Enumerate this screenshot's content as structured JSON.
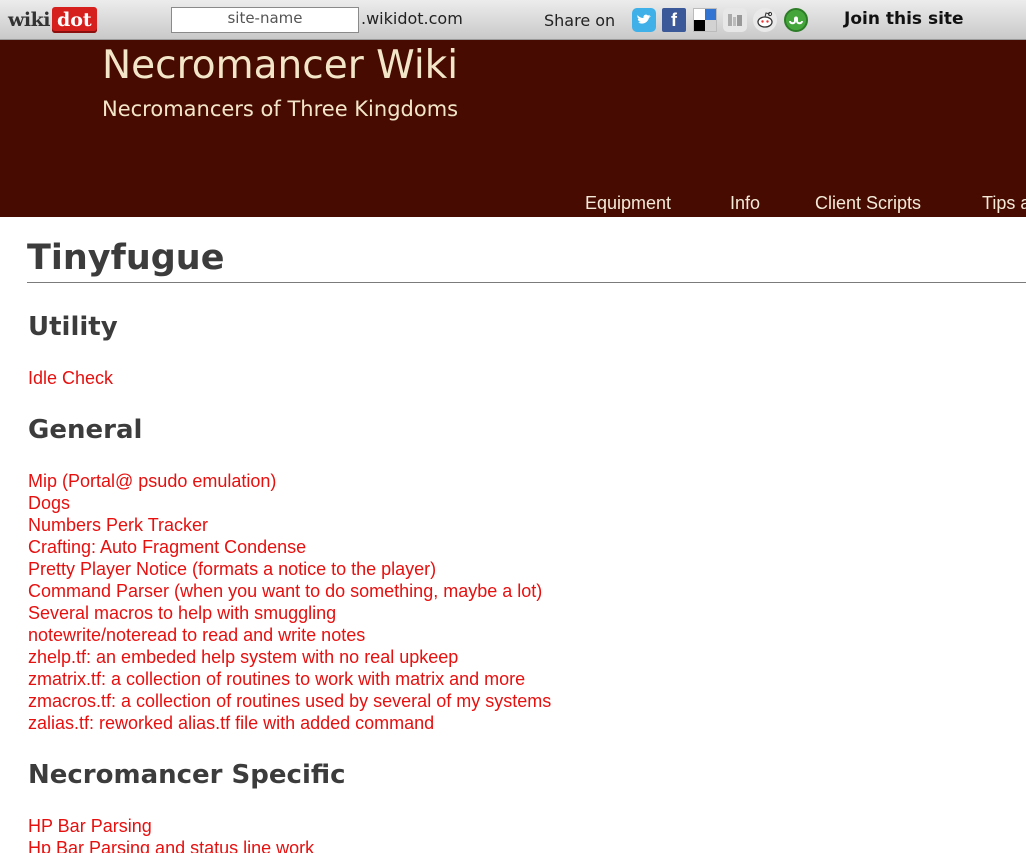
{
  "wikidot_bar": {
    "logo_wiki": "wiki",
    "logo_dot": "dot",
    "site_name_placeholder": "site-name",
    "domain_suffix": ".wikidot.com",
    "share_label": "Share on",
    "share_icons": [
      "twitter-icon",
      "facebook-icon",
      "delicious-icon",
      "digg-icon",
      "reddit-icon",
      "stumbleupon-icon"
    ],
    "facebook_glyph": "f",
    "join_label": "Join this site"
  },
  "header": {
    "title": "Necromancer Wiki",
    "subtitle": "Necromancers of Three Kingdoms",
    "background_color": "#470b02",
    "text_color": "#f3e6c8"
  },
  "nav": {
    "items": [
      "Equipment",
      "Info",
      "Client Scripts",
      "Tips a"
    ]
  },
  "page": {
    "title": "Tinyfugue",
    "link_color": "#e6100f",
    "sections": [
      {
        "heading": "Utility",
        "links": [
          "Idle Check"
        ]
      },
      {
        "heading": "General",
        "links": [
          "Mip (Portal@ psudo emulation)",
          "Dogs",
          "Numbers Perk Tracker",
          "Crafting: Auto Fragment Condense",
          "Pretty Player Notice (formats a notice to the player)",
          "Command Parser (when you want to do something, maybe a lot)",
          "Several macros to help with smuggling",
          "notewrite/noteread to read and write notes",
          "zhelp.tf: an embeded help system with no real upkeep",
          "zmatrix.tf: a collection of routines to work with matrix and more",
          "zmacros.tf: a collection of routines used by several of my systems",
          "zalias.tf: reworked alias.tf file with added command"
        ]
      },
      {
        "heading": "Necromancer Specific",
        "links": [
          "HP Bar Parsing",
          "Hp Bar Parsing and status line work"
        ]
      }
    ]
  }
}
